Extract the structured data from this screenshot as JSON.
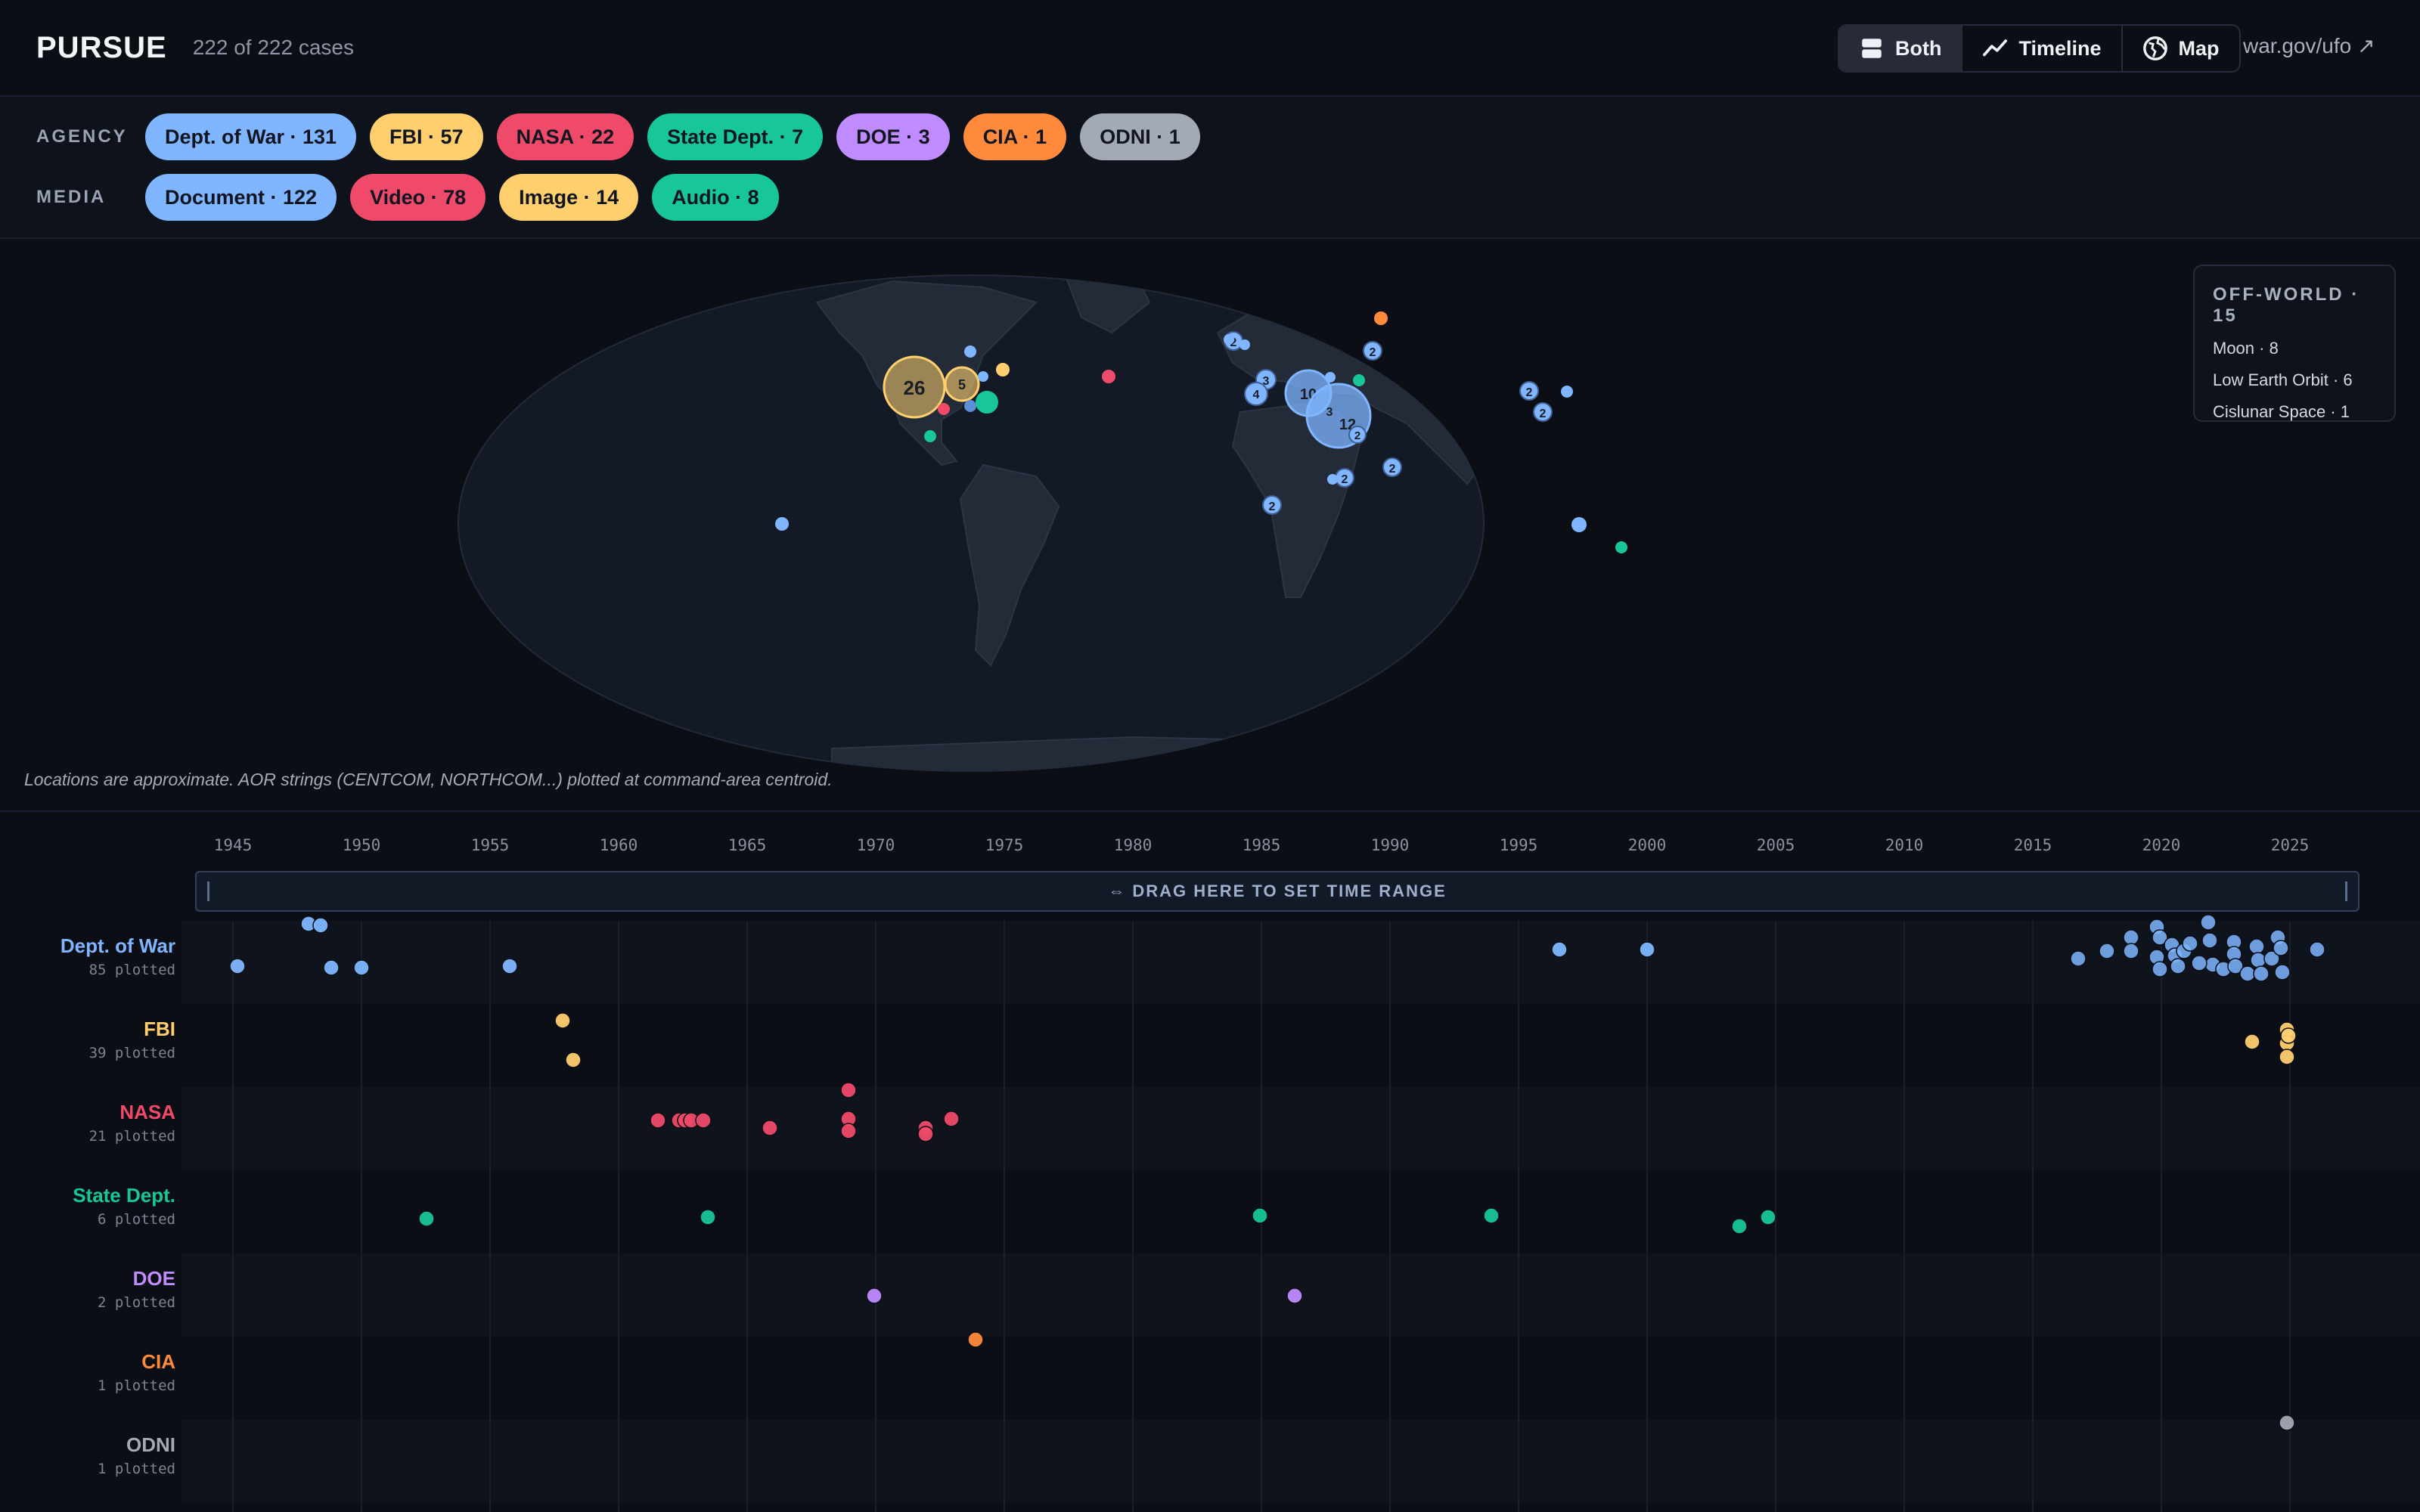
{
  "header": {
    "brand": "PURSUE",
    "case_count": "222 of 222 cases",
    "view_modes": [
      {
        "label": "Both",
        "icon": "both-layout-icon",
        "active": true
      },
      {
        "label": "Timeline",
        "icon": "timeline-icon",
        "active": false
      },
      {
        "label": "Map",
        "icon": "globe-icon",
        "active": false
      }
    ],
    "external_link": "war.gov/ufo ↗"
  },
  "filters": {
    "agency_label": "AGENCY",
    "agencies": [
      {
        "label": "Dept. of War · 131",
        "color": "#7fb6ff"
      },
      {
        "label": "FBI · 57",
        "color": "#ffcf6e"
      },
      {
        "label": "NASA · 22",
        "color": "#f04a6a"
      },
      {
        "label": "State Dept. · 7",
        "color": "#17c79a"
      },
      {
        "label": "DOE · 3",
        "color": "#c08bff"
      },
      {
        "label": "CIA · 1",
        "color": "#ff8a3c"
      },
      {
        "label": "ODNI · 1",
        "color": "#a3a9b5"
      }
    ],
    "media_label": "MEDIA",
    "media": [
      {
        "label": "Document · 122",
        "color": "#7fb6ff"
      },
      {
        "label": "Video · 78",
        "color": "#f04a6a"
      },
      {
        "label": "Image · 14",
        "color": "#ffcf6e"
      },
      {
        "label": "Audio · 8",
        "color": "#17c79a"
      }
    ]
  },
  "map": {
    "note": "Locations are approximate. AOR strings (CENTCOM, NORTHCOM...) plotted at command-area centroid.",
    "cluster_labels": [
      "26",
      "5",
      "3",
      "10",
      "3",
      "12",
      "2",
      "2",
      "2",
      "2",
      "2",
      "2",
      "2",
      "2",
      "4",
      "2",
      "2"
    ],
    "off_world": {
      "title": "OFF-WORLD · 15",
      "items": [
        "Moon · 8",
        "Low Earth Orbit · 6",
        "Cislunar Space · 1"
      ]
    }
  },
  "timeline": {
    "years": [
      "1945",
      "1950",
      "1955",
      "1960",
      "1965",
      "1970",
      "1975",
      "1980",
      "1985",
      "1990",
      "1995",
      "2000",
      "2005",
      "2010",
      "2015",
      "2020",
      "2025"
    ],
    "brush_label": "⇔ DRAG HERE TO SET TIME RANGE",
    "lanes": [
      {
        "name": "Dept. of War",
        "sub": "85 plotted",
        "color": "#7fb6ff"
      },
      {
        "name": "FBI",
        "sub": "39 plotted",
        "color": "#ffcf6e"
      },
      {
        "name": "NASA",
        "sub": "21 plotted",
        "color": "#f04a6a"
      },
      {
        "name": "State Dept.",
        "sub": "6 plotted",
        "color": "#17c79a"
      },
      {
        "name": "DOE",
        "sub": "2 plotted",
        "color": "#c08bff"
      },
      {
        "name": "CIA",
        "sub": "1 plotted",
        "color": "#ff8a3c"
      },
      {
        "name": "ODNI",
        "sub": "1 plotted",
        "color": "#a3a9b5"
      }
    ]
  }
}
